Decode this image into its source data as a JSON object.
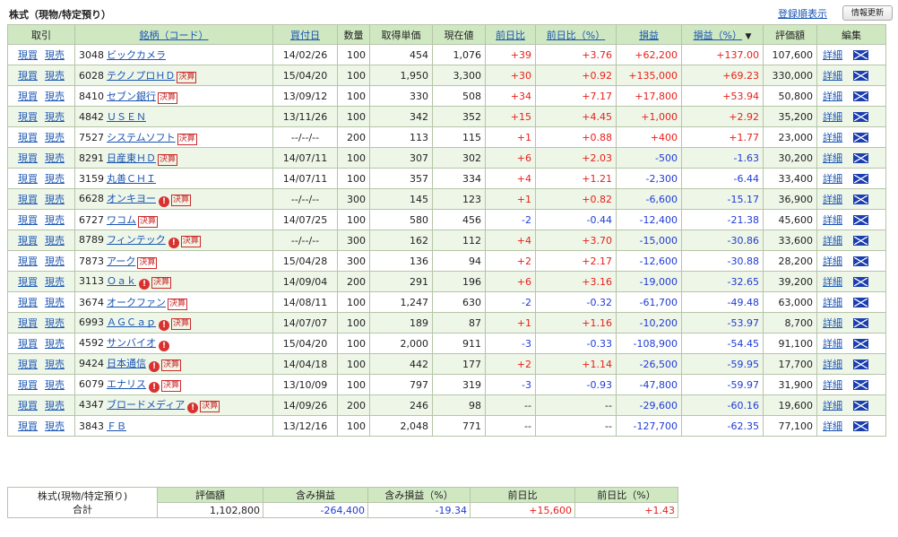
{
  "header": {
    "title": "株式（現物/特定預り）",
    "reg_link": "登録順表示",
    "refresh_label": "情報更新"
  },
  "columns": {
    "trade": "取引",
    "name": "銘柄（コード）",
    "date": "買付日",
    "qty": "数量",
    "cost": "取得単価",
    "price": "現在値",
    "chg": "前日比",
    "chgpct": "前日比（%）",
    "pl": "損益",
    "plpct": "損益（%）",
    "sort_mark": "▼",
    "value": "評価額",
    "edit": "編集"
  },
  "links": {
    "buy": "現買",
    "sell": "現売",
    "detail": "詳細",
    "kessan": "決算",
    "alert": "!"
  },
  "colors": {
    "header_bg": "#cfe8c2",
    "row_alt_bg": "#eef6e8",
    "positive": "#e8201a",
    "negative": "#1f3bd6",
    "link": "#1a55b3"
  },
  "rows": [
    {
      "code": "3048",
      "name": "ビックカメラ",
      "alert": false,
      "kessan": false,
      "date": "14/02/26",
      "qty": "100",
      "cost": "454",
      "price": "1,076",
      "chg": "+39",
      "chgpct": "+3.76",
      "pl": "+62,200",
      "plpct": "+137.00",
      "value": "107,600"
    },
    {
      "code": "6028",
      "name": "テクノプロＨＤ",
      "alert": false,
      "kessan": true,
      "date": "15/04/20",
      "qty": "100",
      "cost": "1,950",
      "price": "3,300",
      "chg": "+30",
      "chgpct": "+0.92",
      "pl": "+135,000",
      "plpct": "+69.23",
      "value": "330,000"
    },
    {
      "code": "8410",
      "name": "セブン銀行",
      "alert": false,
      "kessan": true,
      "date": "13/09/12",
      "qty": "100",
      "cost": "330",
      "price": "508",
      "chg": "+34",
      "chgpct": "+7.17",
      "pl": "+17,800",
      "plpct": "+53.94",
      "value": "50,800"
    },
    {
      "code": "4842",
      "name": "ＵＳＥＮ",
      "alert": false,
      "kessan": false,
      "date": "13/11/26",
      "qty": "100",
      "cost": "342",
      "price": "352",
      "chg": "+15",
      "chgpct": "+4.45",
      "pl": "+1,000",
      "plpct": "+2.92",
      "value": "35,200"
    },
    {
      "code": "7527",
      "name": "システムソフト",
      "alert": false,
      "kessan": true,
      "date": "--/--/--",
      "qty": "200",
      "cost": "113",
      "price": "115",
      "chg": "+1",
      "chgpct": "+0.88",
      "pl": "+400",
      "plpct": "+1.77",
      "value": "23,000"
    },
    {
      "code": "8291",
      "name": "日産東ＨＤ",
      "alert": false,
      "kessan": true,
      "date": "14/07/11",
      "qty": "100",
      "cost": "307",
      "price": "302",
      "chg": "+6",
      "chgpct": "+2.03",
      "pl": "-500",
      "plpct": "-1.63",
      "value": "30,200"
    },
    {
      "code": "3159",
      "name": "丸善ＣＨＩ",
      "alert": false,
      "kessan": false,
      "date": "14/07/11",
      "qty": "100",
      "cost": "357",
      "price": "334",
      "chg": "+4",
      "chgpct": "+1.21",
      "pl": "-2,300",
      "plpct": "-6.44",
      "value": "33,400"
    },
    {
      "code": "6628",
      "name": "オンキヨー",
      "alert": true,
      "kessan": true,
      "date": "--/--/--",
      "qty": "300",
      "cost": "145",
      "price": "123",
      "chg": "+1",
      "chgpct": "+0.82",
      "pl": "-6,600",
      "plpct": "-15.17",
      "value": "36,900"
    },
    {
      "code": "6727",
      "name": "ワコム",
      "alert": false,
      "kessan": true,
      "date": "14/07/25",
      "qty": "100",
      "cost": "580",
      "price": "456",
      "chg": "-2",
      "chgpct": "-0.44",
      "pl": "-12,400",
      "plpct": "-21.38",
      "value": "45,600"
    },
    {
      "code": "8789",
      "name": "フィンテック",
      "alert": true,
      "kessan": true,
      "date": "--/--/--",
      "qty": "300",
      "cost": "162",
      "price": "112",
      "chg": "+4",
      "chgpct": "+3.70",
      "pl": "-15,000",
      "plpct": "-30.86",
      "value": "33,600"
    },
    {
      "code": "7873",
      "name": "アーク",
      "alert": false,
      "kessan": true,
      "date": "15/04/28",
      "qty": "300",
      "cost": "136",
      "price": "94",
      "chg": "+2",
      "chgpct": "+2.17",
      "pl": "-12,600",
      "plpct": "-30.88",
      "value": "28,200"
    },
    {
      "code": "3113",
      "name": "Ｏａｋ",
      "alert": true,
      "kessan": true,
      "date": "14/09/04",
      "qty": "200",
      "cost": "291",
      "price": "196",
      "chg": "+6",
      "chgpct": "+3.16",
      "pl": "-19,000",
      "plpct": "-32.65",
      "value": "39,200"
    },
    {
      "code": "3674",
      "name": "オークファン",
      "alert": false,
      "kessan": true,
      "date": "14/08/11",
      "qty": "100",
      "cost": "1,247",
      "price": "630",
      "chg": "-2",
      "chgpct": "-0.32",
      "pl": "-61,700",
      "plpct": "-49.48",
      "value": "63,000"
    },
    {
      "code": "6993",
      "name": "ＡＧＣａｐ",
      "alert": true,
      "kessan": true,
      "date": "14/07/07",
      "qty": "100",
      "cost": "189",
      "price": "87",
      "chg": "+1",
      "chgpct": "+1.16",
      "pl": "-10,200",
      "plpct": "-53.97",
      "value": "8,700"
    },
    {
      "code": "4592",
      "name": "サンバイオ",
      "alert": true,
      "kessan": false,
      "date": "15/04/20",
      "qty": "100",
      "cost": "2,000",
      "price": "911",
      "chg": "-3",
      "chgpct": "-0.33",
      "pl": "-108,900",
      "plpct": "-54.45",
      "value": "91,100"
    },
    {
      "code": "9424",
      "name": "日本通信",
      "alert": true,
      "kessan": true,
      "date": "14/04/18",
      "qty": "100",
      "cost": "442",
      "price": "177",
      "chg": "+2",
      "chgpct": "+1.14",
      "pl": "-26,500",
      "plpct": "-59.95",
      "value": "17,700"
    },
    {
      "code": "6079",
      "name": "エナリス",
      "alert": true,
      "kessan": true,
      "date": "13/10/09",
      "qty": "100",
      "cost": "797",
      "price": "319",
      "chg": "-3",
      "chgpct": "-0.93",
      "pl": "-47,800",
      "plpct": "-59.97",
      "value": "31,900"
    },
    {
      "code": "4347",
      "name": "ブロードメディア",
      "alert": true,
      "kessan": true,
      "date": "14/09/26",
      "qty": "200",
      "cost": "246",
      "price": "98",
      "chg": "--",
      "chgpct": "--",
      "pl": "-29,600",
      "plpct": "-60.16",
      "value": "19,600"
    },
    {
      "code": "3843",
      "name": "ＦＢ",
      "alert": false,
      "kessan": false,
      "date": "13/12/16",
      "qty": "100",
      "cost": "2,048",
      "price": "771",
      "chg": "--",
      "chgpct": "--",
      "pl": "-127,700",
      "plpct": "-62.35",
      "value": "77,100"
    }
  ],
  "summary": {
    "label_line1": "株式(現物/特定預り)",
    "label_line2": "合計",
    "headers": [
      "評価額",
      "含み損益",
      "含み損益（%）",
      "前日比",
      "前日比（%）"
    ],
    "values": [
      "1,102,800",
      "-264,400",
      "-19.34",
      "+15,600",
      "+1.43"
    ]
  }
}
